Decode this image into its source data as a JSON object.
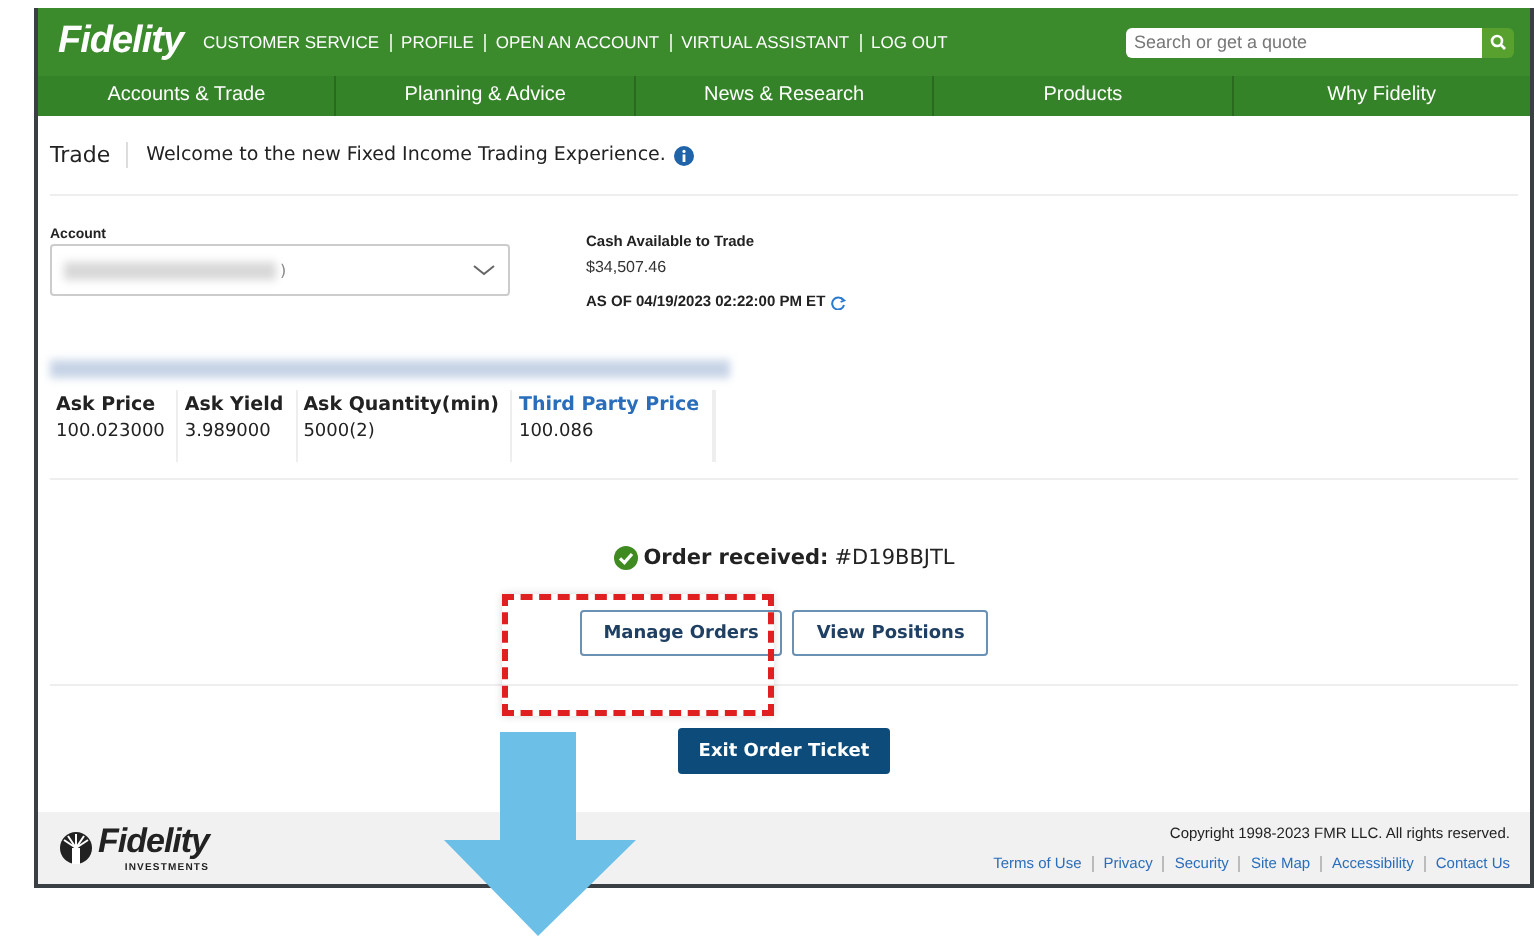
{
  "header": {
    "brand": "Fidelity",
    "links": [
      "CUSTOMER SERVICE",
      "PROFILE",
      "OPEN AN ACCOUNT",
      "VIRTUAL ASSISTANT",
      "LOG OUT"
    ],
    "search": {
      "placeholder": "Search or get a quote"
    }
  },
  "nav": [
    "Accounts & Trade",
    "Planning & Advice",
    "News & Research",
    "Products",
    "Why Fidelity"
  ],
  "trade": {
    "title": "Trade",
    "welcome": "Welcome to the new Fixed Income Trading Experience."
  },
  "account": {
    "label": "Account",
    "value_suffix": ")"
  },
  "cash": {
    "label": "Cash Available to Trade",
    "amount": "$34,507.46",
    "as_of": "AS OF 04/19/2023 02:22:00 PM ET"
  },
  "quote": {
    "columns": [
      {
        "label": "Ask Price",
        "kind": "plain",
        "value": "100.023000"
      },
      {
        "label": "Ask Yield",
        "kind": "plain",
        "value": "3.989000"
      },
      {
        "label": "Ask Quantity(min)",
        "kind": "plain",
        "value": "5000(2)"
      },
      {
        "label": "Third Party Price",
        "kind": "link",
        "value": "100.086"
      }
    ]
  },
  "order": {
    "label": "Order received:",
    "number": "#D19BBJTL"
  },
  "buttons": [
    "Manage Orders",
    "View Positions"
  ],
  "exit_button": "Exit Order Ticket",
  "footer": {
    "brand": "Fidelity",
    "sub": "INVESTMENTS",
    "copyright": "Copyright 1998-2023 FMR LLC. All rights reserved.",
    "links": [
      "Terms of Use",
      "Privacy",
      "Security",
      "Site Map",
      "Accessibility",
      "Contact Us"
    ]
  }
}
